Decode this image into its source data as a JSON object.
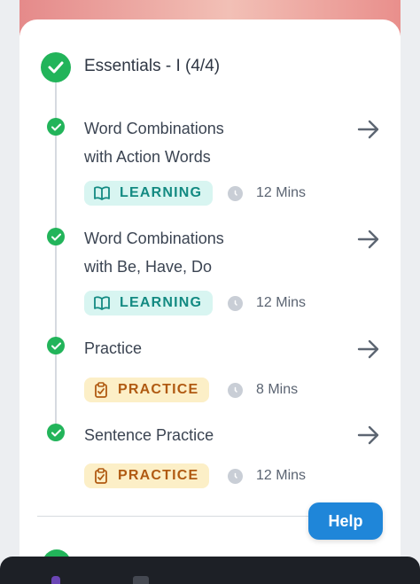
{
  "section": {
    "title": "Essentials - I (4/4)",
    "icon": "check-circle-icon",
    "accent_color": "#22b45a"
  },
  "items": [
    {
      "title_line1": "Word Combinations",
      "title_line2": "with Action Words",
      "badge": "LEARNING",
      "badge_icon": "book-open-icon",
      "duration": "12 Mins"
    },
    {
      "title_line1": "Word Combinations",
      "title_line2": "with Be, Have, Do",
      "badge": "LEARNING",
      "badge_icon": "book-open-icon",
      "duration": "12 Mins"
    },
    {
      "title_line1": "Practice",
      "title_line2": "",
      "badge": "PRACTICE",
      "badge_icon": "clipboard-check-icon",
      "duration": "8 Mins"
    },
    {
      "title_line1": "Sentence Practice",
      "title_line2": "",
      "badge": "PRACTICE",
      "badge_icon": "clipboard-check-icon",
      "duration": "12 Mins"
    }
  ],
  "help": {
    "label": "Help",
    "color": "#1f86d9"
  },
  "colors": {
    "learning_bg": "#d8f5f1",
    "learning_text": "#138a82",
    "practice_bg": "#fcefc7",
    "practice_text": "#b05a12"
  }
}
